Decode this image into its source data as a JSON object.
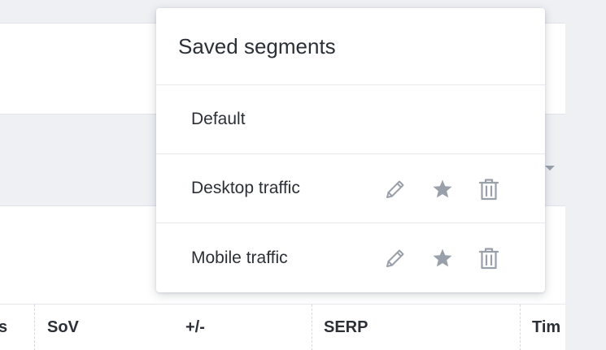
{
  "dropdown": {
    "title": "Saved segments",
    "items": [
      {
        "label": "Default",
        "actions": []
      },
      {
        "label": "Desktop traffic",
        "actions": [
          "pencil-icon",
          "star-icon",
          "trash-icon"
        ]
      },
      {
        "label": "Mobile traffic",
        "actions": [
          "pencil-icon",
          "star-icon",
          "trash-icon"
        ]
      }
    ]
  },
  "table": {
    "columns": [
      "s",
      "SoV",
      "+/-",
      "SERP",
      "Tim"
    ]
  },
  "colors": {
    "icon": "#9aa0aa",
    "text": "#2b2f36",
    "background": "#eef0f4"
  }
}
